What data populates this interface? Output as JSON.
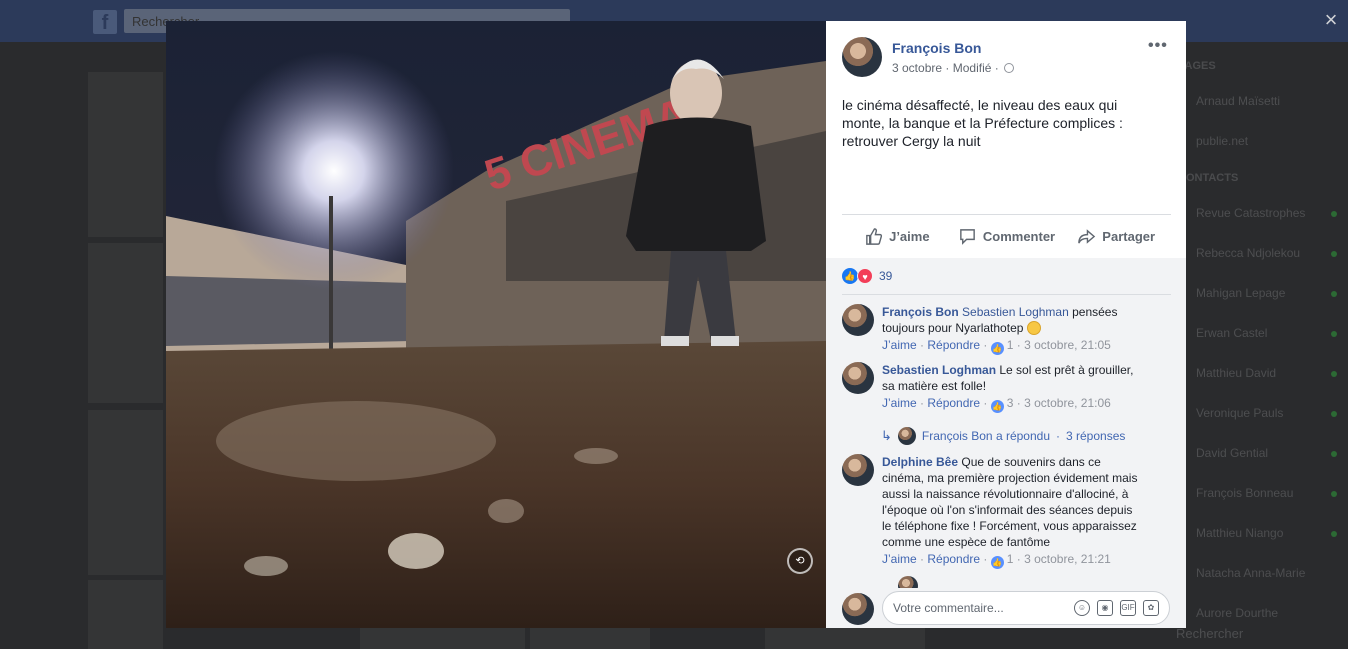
{
  "background": {
    "search_placeholder": "Rechercher",
    "sidebar_headers": [
      "PAGES",
      "CONTACTS"
    ],
    "sidebar_pages": [
      "Arnaud Maïsetti",
      "publie.net"
    ],
    "sidebar_contacts": [
      "Revue Catastrophes",
      "Rebecca Ndjolekou",
      "Mahigan Lepage",
      "Erwan Castel",
      "Matthieu David",
      "Veronique Pauls",
      "David Gential",
      "François Bonneau",
      "Matthieu Niango",
      "Natacha Anna-Marie",
      "Aurore Dourthe"
    ],
    "bottom_search": "Rechercher",
    "close_label": "×"
  },
  "post": {
    "author": "François Bon",
    "date": "3 octobre",
    "meta_separator": "·",
    "edited": "Modifié",
    "text": "le cinéma désaffecté, le niveau des eaux qui monte, la banque et la Préfecture complices : retrouver Cergy la nuit",
    "more_label": "•••",
    "photo_sign": "5 CINEMA"
  },
  "actions": {
    "like": "J’aime",
    "comment": "Commenter",
    "share": "Partager"
  },
  "reactions": {
    "count": "39",
    "types": [
      "like",
      "love"
    ]
  },
  "comments": [
    {
      "author": "François Bon",
      "mention": "Sebastien Loghman",
      "text": " pensées toujours pour Nyarlathotep ",
      "like": "J’aime",
      "reply": "Répondre",
      "likes": "1",
      "time": "3 octobre, 21:05"
    },
    {
      "author": "Sebastien Loghman",
      "text": " Le sol est prêt à grouiller, sa matière est folle!",
      "like": "J’aime",
      "reply": "Répondre",
      "likes": "3",
      "time": "3 octobre, 21:06",
      "replies": {
        "author": "François Bon a répondu",
        "count": "3 réponses"
      }
    },
    {
      "author": "Delphine Bêe",
      "text": " Que de souvenirs dans ce cinéma, ma première projection évidement mais aussi la naissance révolutionnaire d'allociné, à l'époque où l'on s'informait des séances depuis le téléphone fixe ! Forcément, vous apparaissez comme une espèce de fantôme",
      "like": "J’aime",
      "reply": "Répondre",
      "likes": "1",
      "time": "3 octobre, 21:21"
    }
  ],
  "composer": {
    "placeholder": "Votre commentaire...",
    "icons": [
      "emoji-icon",
      "camera-icon",
      "gif-icon",
      "sticker-icon"
    ],
    "gif_label": "GIF"
  },
  "colors": {
    "link": "#385898",
    "like_blue": "#1877f2",
    "love_red": "#f33e58"
  }
}
